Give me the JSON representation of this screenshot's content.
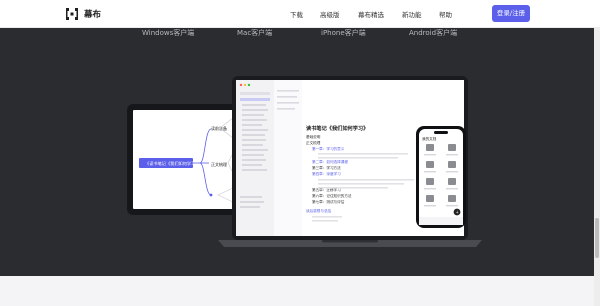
{
  "brand": {
    "name": "幕布"
  },
  "nav": {
    "download": "下载",
    "pro": "高级版",
    "featured": "幕布精选",
    "new_features": "新功能",
    "help": "帮助",
    "login": "登录/注册"
  },
  "clients": [
    "Windows客户端",
    "Mac客户端",
    "iPhone客户端",
    "Android客户端"
  ],
  "tablet_mindmap": {
    "root": "《读书笔记《我们如何学习》",
    "node_a": "读前准备",
    "node_b": "正文梳理"
  },
  "laptop_doc": {
    "title": "读书笔记《我们如何学习》",
    "lines": [
      "基础说明",
      "正文梳理",
      "第一章：学习的意义",
      "第二章：如何选择课程",
      "第三章：学习方法",
      "第四章：深度学习",
      "第五章：迁移学习",
      "第六章：记住知识的方法",
      "第七章：测试与评估",
      "读后感想与总结"
    ]
  },
  "phone": {
    "header": "我的文档"
  },
  "colors": {
    "accent": "#5b5fe9",
    "dark_band": "#2b2c30"
  }
}
